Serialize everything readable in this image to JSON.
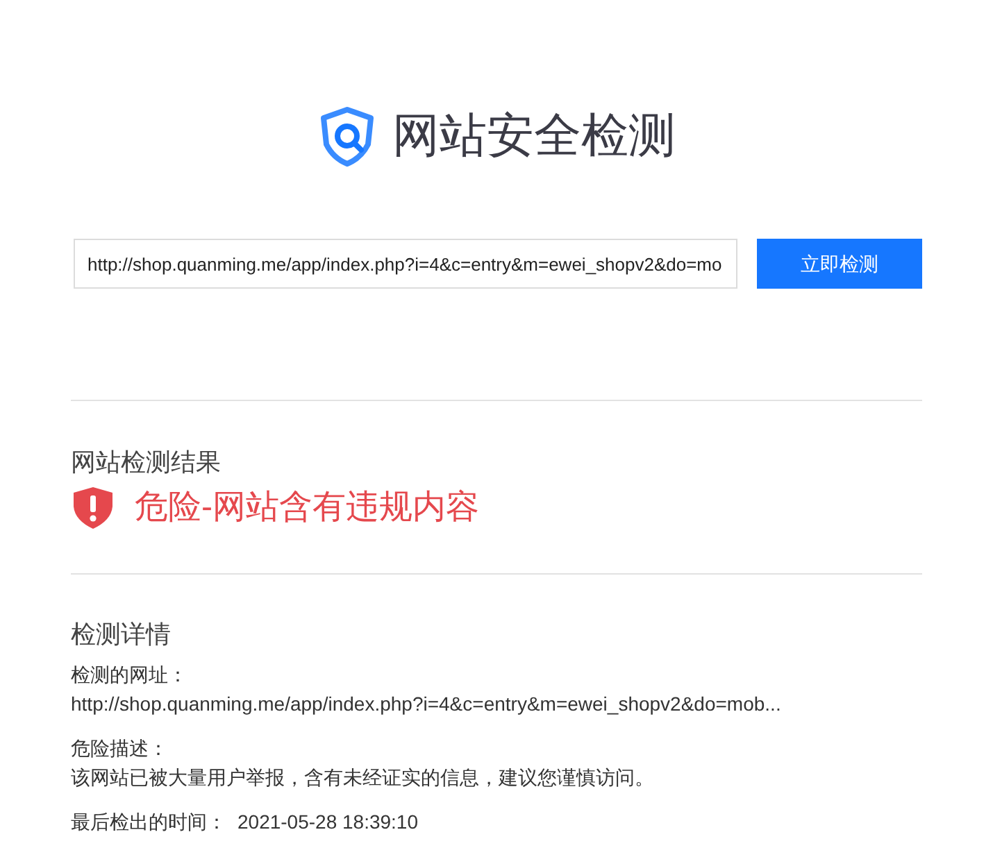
{
  "header": {
    "title": "网站安全检测"
  },
  "search": {
    "value": "http://shop.quanming.me/app/index.php?i=4&c=entry&m=ewei_shopv2&do=mo",
    "button": "立即检测"
  },
  "result": {
    "heading": "网站检测结果",
    "danger": true,
    "verdict": "危险-网站含有违规内容"
  },
  "details": {
    "heading": "检测详情",
    "fields": [
      {
        "kind": "block",
        "label": "检测的网址：",
        "value": "http://shop.quanming.me/app/index.php?i=4&c=entry&m=ewei_shopv2&do=mob..."
      },
      {
        "kind": "block",
        "label": "危险描述：",
        "value": "该网站已被大量用户举报，含有未经证实的信息，建议您谨慎访问。"
      },
      {
        "label": "最后检出的时间：",
        "value": "2021-05-28 18:39:10",
        "kind": "inline"
      }
    ]
  }
}
